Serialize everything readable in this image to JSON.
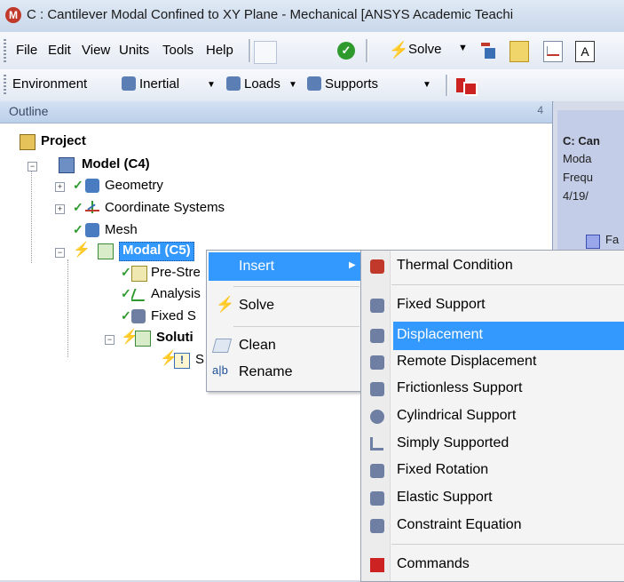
{
  "window": {
    "title": "C : Cantilever Modal Confined to XY Plane - Mechanical [ANSYS Academic Teachi",
    "app_icon": "M"
  },
  "menubar": {
    "items": [
      "File",
      "Edit",
      "View",
      "Units",
      "Tools",
      "Help"
    ],
    "solve_label": "Solve"
  },
  "envbar": {
    "environment": "Environment",
    "inertial": "Inertial",
    "loads": "Loads",
    "supports": "Supports"
  },
  "outline": {
    "header": "Outline",
    "pin": "4",
    "tree": [
      {
        "label": "Project",
        "bold": true
      },
      {
        "label": "Model (C4)",
        "bold": true
      },
      {
        "label": "Geometry"
      },
      {
        "label": "Coordinate Systems"
      },
      {
        "label": "Mesh"
      },
      {
        "label": "Modal (C5)",
        "bold": true,
        "selected": true
      },
      {
        "label": "Pre-Stre"
      },
      {
        "label": "Analysis"
      },
      {
        "label": "Fixed S"
      },
      {
        "label": "Soluti",
        "bold": true
      },
      {
        "label": "S"
      }
    ]
  },
  "details": {
    "lines": [
      "C: Can",
      "Moda",
      "Frequ",
      "4/19/",
      "Fa"
    ]
  },
  "context_menu": {
    "items": [
      {
        "label": "Insert",
        "highlighted": true,
        "submenu": true
      },
      {
        "label": "Solve",
        "icon": "lightning-icon"
      },
      {
        "label": "Clean",
        "icon": "eraser-icon"
      },
      {
        "label": "Rename",
        "icon": "rename-icon"
      }
    ]
  },
  "submenu": {
    "items": [
      {
        "label": "Thermal Condition"
      },
      {
        "label": "Fixed Support"
      },
      {
        "label": "Displacement",
        "highlighted": true
      },
      {
        "label": "Remote Displacement"
      },
      {
        "label": "Frictionless Support"
      },
      {
        "label": "Cylindrical Support"
      },
      {
        "label": "Simply Supported"
      },
      {
        "label": "Fixed Rotation"
      },
      {
        "label": "Elastic Support"
      },
      {
        "label": "Constraint Equation"
      },
      {
        "label": "Commands"
      }
    ]
  },
  "colors": {
    "highlight": "#3399ff",
    "check_green": "#2e9a2e",
    "bolt_yellow": "#e7b800",
    "commands_red": "#cc2222"
  }
}
